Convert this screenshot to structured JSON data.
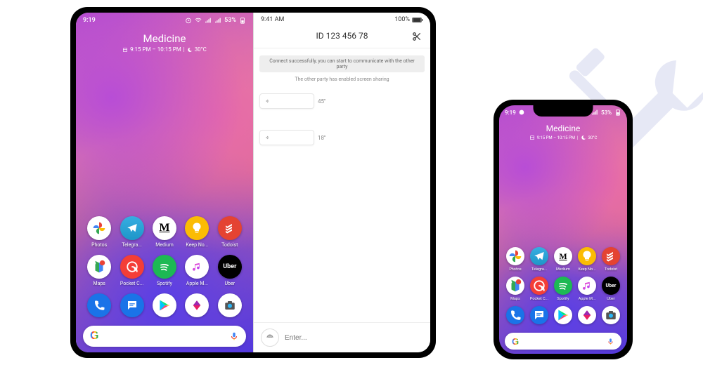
{
  "bg_icon": "tools-wrench-screwdriver",
  "tablet": {
    "left": {
      "status": {
        "time": "9:19",
        "battery": "53%"
      },
      "widget": {
        "title": "Medicine",
        "time_range": "9:15 PM – 10:15 PM",
        "temp": "30°C"
      },
      "apps": [
        {
          "name": "photos",
          "label": "Photos"
        },
        {
          "name": "telegram",
          "label": "Telegra..."
        },
        {
          "name": "medium",
          "label": "Medium"
        },
        {
          "name": "keep",
          "label": "Keep No..."
        },
        {
          "name": "todoist",
          "label": "Todoist"
        },
        {
          "name": "maps",
          "label": "Maps"
        },
        {
          "name": "pocketcasts",
          "label": "Pocket C..."
        },
        {
          "name": "spotify",
          "label": "Spotify"
        },
        {
          "name": "applemusic",
          "label": "Apple M..."
        },
        {
          "name": "uber",
          "label": "Uber"
        }
      ],
      "dock": [
        {
          "name": "phone"
        },
        {
          "name": "messages"
        },
        {
          "name": "play"
        },
        {
          "name": "unknown"
        },
        {
          "name": "camera"
        }
      ],
      "search": {
        "placeholder": ""
      }
    },
    "right": {
      "status": {
        "time": "9:41 AM",
        "battery": "100%"
      },
      "title": "ID 123 456 78",
      "banner": "Connect successfully, you can start to communicate with the other party",
      "note": "The other party has enabled screen sharing",
      "voice_msgs": [
        {
          "duration": "45''"
        },
        {
          "duration": "18''"
        }
      ],
      "input_placeholder": "Enter..."
    }
  },
  "phone": {
    "status": {
      "time": "9:19",
      "battery": "53%"
    },
    "widget": {
      "title": "Medicine",
      "time_range": "9:15 PM – 10:15 PM",
      "temp": "30°C"
    },
    "apps": [
      {
        "name": "photos",
        "label": "Photos"
      },
      {
        "name": "telegram",
        "label": "Telegra..."
      },
      {
        "name": "medium",
        "label": "Medium"
      },
      {
        "name": "keep",
        "label": "Keep No..."
      },
      {
        "name": "todoist",
        "label": "Todoist"
      },
      {
        "name": "maps",
        "label": "Maps"
      },
      {
        "name": "pocketcasts",
        "label": "Pocket C..."
      },
      {
        "name": "spotify",
        "label": "Spotify"
      },
      {
        "name": "applemusic",
        "label": "Apple M..."
      },
      {
        "name": "uber",
        "label": "Uber"
      }
    ],
    "dock": [
      {
        "name": "phone"
      },
      {
        "name": "messages"
      },
      {
        "name": "play"
      },
      {
        "name": "unknown"
      },
      {
        "name": "camera"
      }
    ]
  }
}
